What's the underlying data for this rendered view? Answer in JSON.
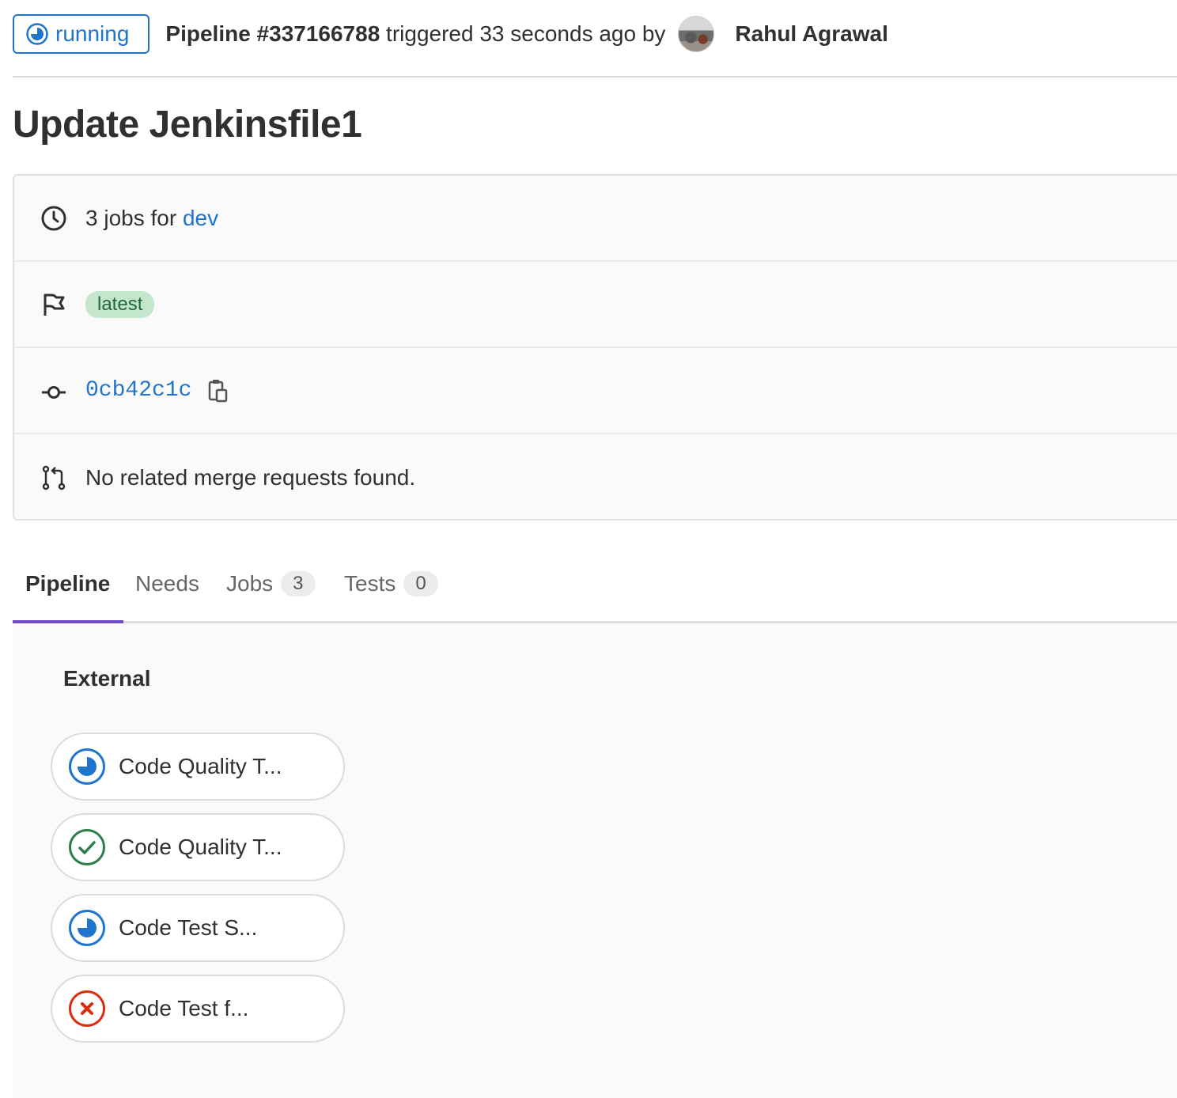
{
  "header": {
    "status": "running",
    "pipeline_label": "Pipeline #337166788",
    "triggered_text": " triggered 33 seconds ago by",
    "author": "Rahul Agrawal"
  },
  "title": "Update Jenkinsfile1",
  "info": {
    "jobs_prefix": "3 jobs for ",
    "branch": "dev",
    "tag": "latest",
    "commit_sha": "0cb42c1c",
    "merge_requests": "No related merge requests found."
  },
  "tabs": [
    {
      "label": "Pipeline",
      "active": true
    },
    {
      "label": "Needs"
    },
    {
      "label": "Jobs",
      "count": "3"
    },
    {
      "label": "Tests",
      "count": "0"
    }
  ],
  "stage": {
    "title": "External",
    "jobs": [
      {
        "name": "Code Quality T...",
        "status": "running"
      },
      {
        "name": "Code Quality T...",
        "status": "success"
      },
      {
        "name": "Code Test S...",
        "status": "running"
      },
      {
        "name": "Code Test f...",
        "status": "failed"
      }
    ]
  },
  "colors": {
    "running": "#1f75cb",
    "success": "#2f7d4d",
    "failed": "#dd2b0e",
    "tab_underline": "#6e49cb",
    "tag_bg": "#c3e6cd"
  }
}
